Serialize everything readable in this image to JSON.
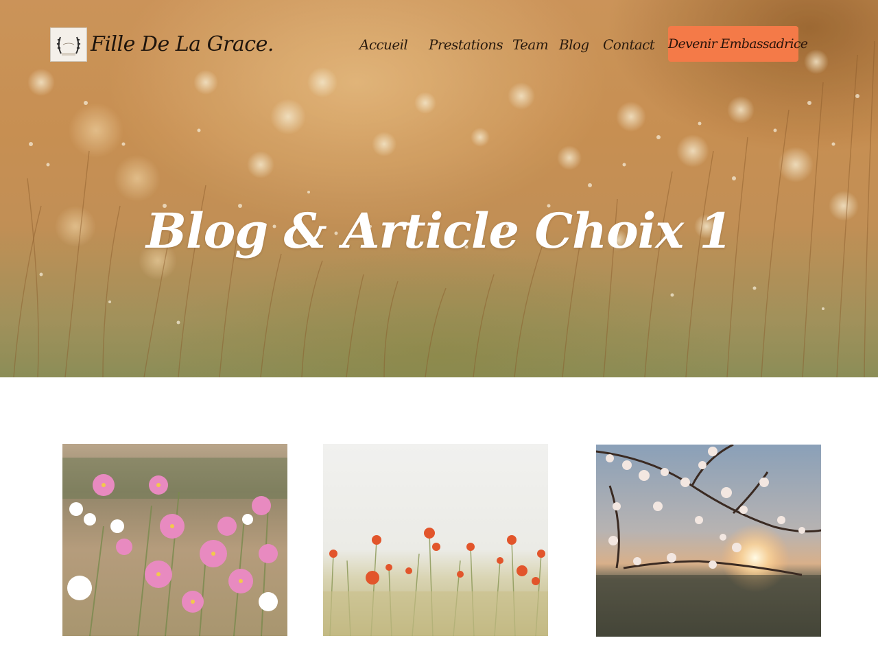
{
  "header": {
    "brand": "Fille De La Grace.",
    "logo_icon": "laurel-wreath-logo-icon",
    "nav": [
      {
        "label": "Accueil"
      },
      {
        "label": "Prestations"
      },
      {
        "label": "Team"
      },
      {
        "label": "Blog"
      },
      {
        "label": "Contact"
      }
    ],
    "cta_label": "Devenir Embassadrice"
  },
  "hero": {
    "title": "Blog & Article Choix 1",
    "background": "golden-meadow-bokeh-photo"
  },
  "cards": [
    {
      "image": "pink-cosmos-flowers-photo"
    },
    {
      "image": "red-poppies-field-photo"
    },
    {
      "image": "cherry-blossom-sunset-photo"
    }
  ],
  "colors": {
    "accent": "#f47a48",
    "hero_text": "#ffffff",
    "nav_text": "#2a1b0e"
  }
}
